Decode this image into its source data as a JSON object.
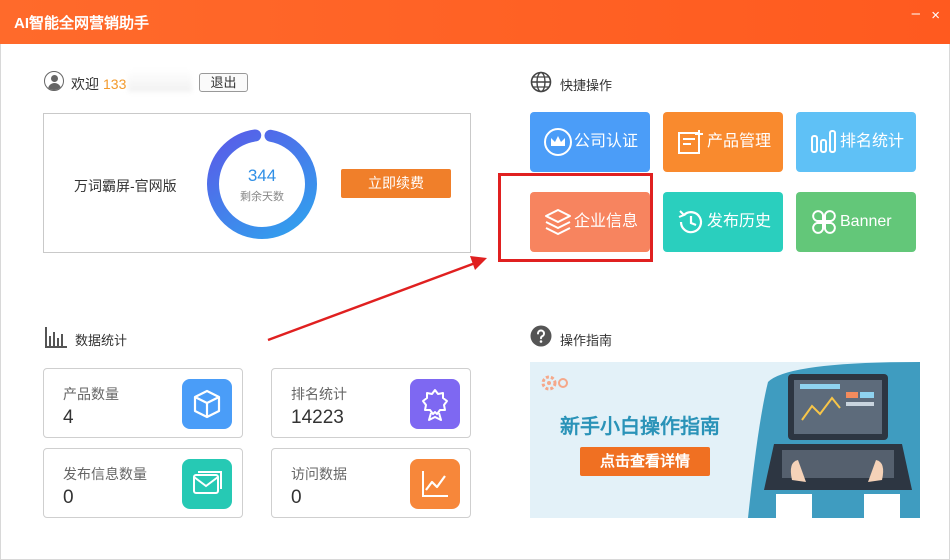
{
  "app": {
    "title": "AI智能全网营销助手"
  },
  "window_controls": {
    "minimize": "–",
    "close": "×"
  },
  "user": {
    "welcome": "欢迎",
    "phone_visible": "133",
    "logout_label": "退出"
  },
  "account": {
    "version_name": "万词霸屏-官网版",
    "days_left": "344",
    "days_left_label": "剩余天数",
    "renew_label": "立即续费"
  },
  "stats": {
    "title": "数据统计",
    "cards": [
      {
        "label": "产品数量",
        "value": "4",
        "icon": "cube-icon",
        "color": "#4a9df8"
      },
      {
        "label": "排名统计",
        "value": "14223",
        "icon": "award-icon",
        "color": "#7e68f2"
      },
      {
        "label": "发布信息数量",
        "value": "0",
        "icon": "mail-icon",
        "color": "#26c9b4"
      },
      {
        "label": "访问数据",
        "value": "0",
        "icon": "chart-icon",
        "color": "#f7873a"
      }
    ]
  },
  "quick": {
    "title": "快捷操作",
    "tiles": [
      {
        "label": "公司认证",
        "icon": "crown-icon",
        "color": "#4b9df8"
      },
      {
        "label": "产品管理",
        "icon": "product-icon",
        "color": "#f98a2e"
      },
      {
        "label": "排名统计",
        "icon": "bar-chart-icon",
        "color": "#5fc1f6"
      },
      {
        "label": "企业信息",
        "icon": "layers-icon",
        "color": "#f7845f"
      },
      {
        "label": "发布历史",
        "icon": "history-icon",
        "color": "#2acfbe"
      },
      {
        "label": "Banner",
        "icon": "clover-icon",
        "color": "#63c779"
      }
    ]
  },
  "guide": {
    "title": "操作指南",
    "banner_title": "新手小白操作指南",
    "banner_button": "点击查看详情"
  },
  "colors": {
    "titlebar": "#ff5a1f",
    "accent_orange": "#f07f2a",
    "donut_start": "#2fa4ee",
    "donut_end": "#5a5ae8",
    "annotation_red": "#e02020"
  }
}
